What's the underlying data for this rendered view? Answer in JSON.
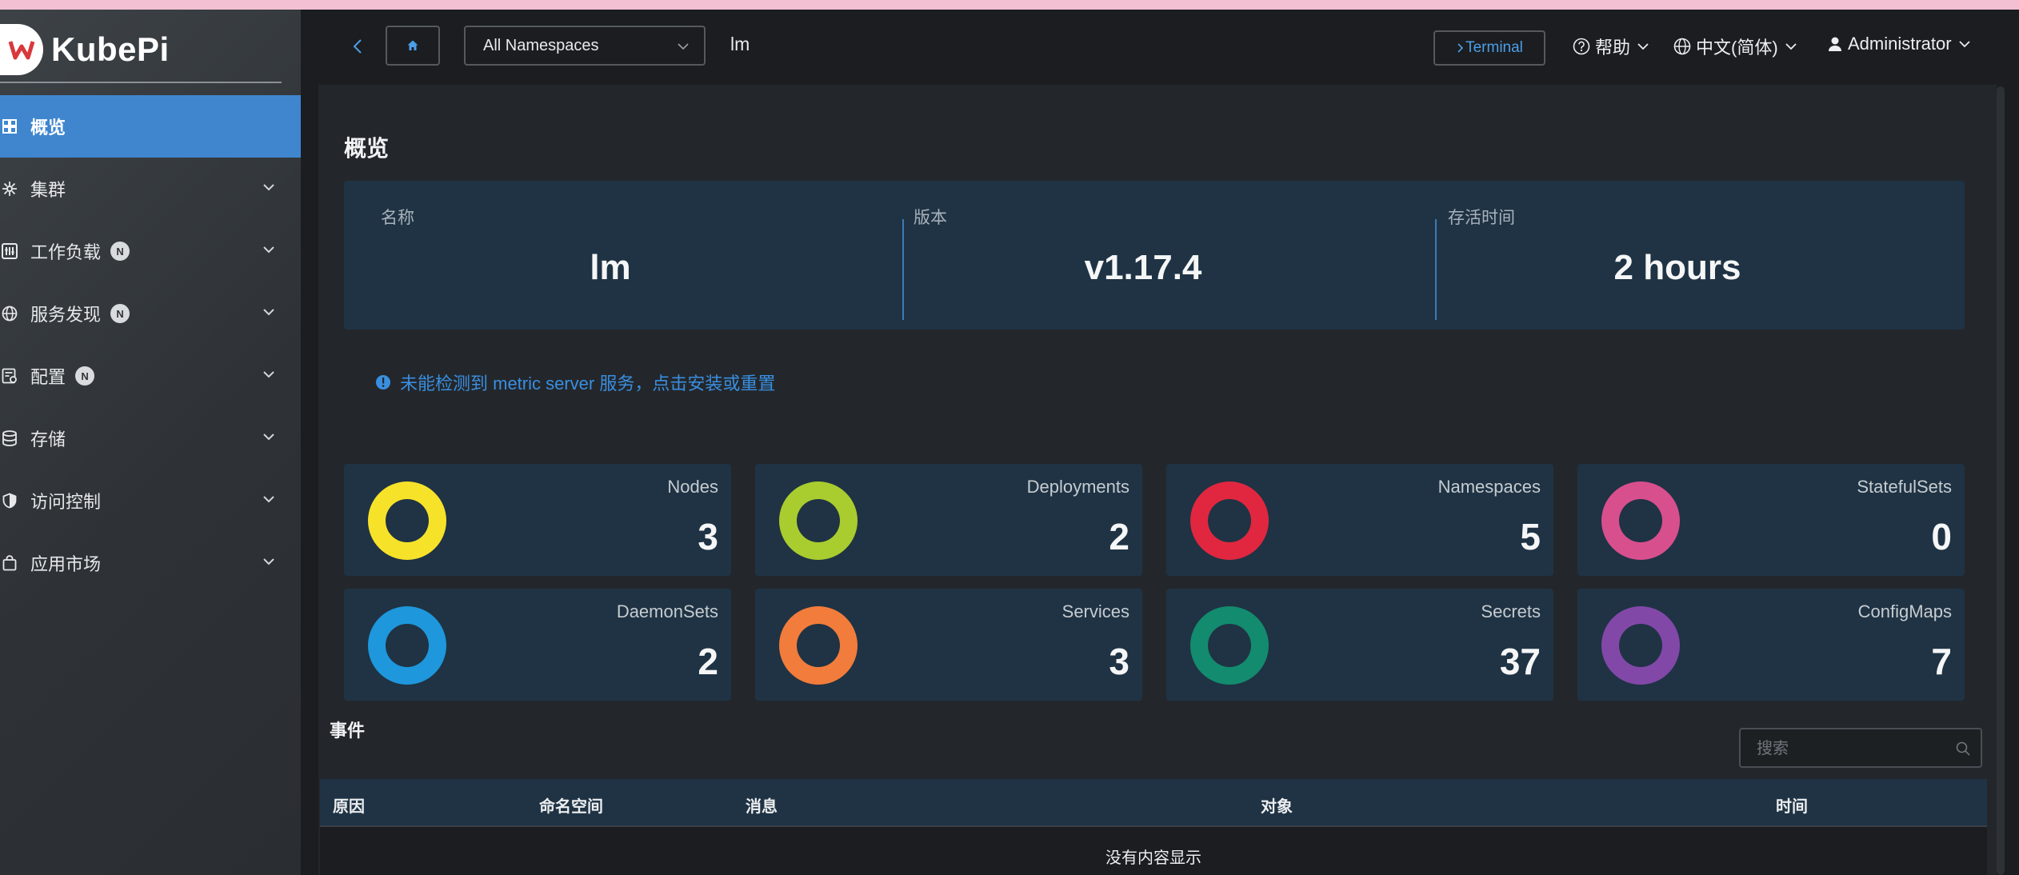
{
  "brand": {
    "name": "KubePi"
  },
  "sidebar": {
    "items": [
      {
        "label": "概览",
        "icon": "dashboard-icon",
        "active": true,
        "badge": "",
        "expandable": false
      },
      {
        "label": "集群",
        "icon": "cluster-icon",
        "active": false,
        "badge": "",
        "expandable": true
      },
      {
        "label": "工作负载",
        "icon": "workload-icon",
        "active": false,
        "badge": "N",
        "expandable": true
      },
      {
        "label": "服务发现",
        "icon": "globe-icon",
        "active": false,
        "badge": "N",
        "expandable": true
      },
      {
        "label": "配置",
        "icon": "config-icon",
        "active": false,
        "badge": "N",
        "expandable": true
      },
      {
        "label": "存储",
        "icon": "database-icon",
        "active": false,
        "badge": "",
        "expandable": true
      },
      {
        "label": "访问控制",
        "icon": "shield-icon",
        "active": false,
        "badge": "",
        "expandable": true
      },
      {
        "label": "应用市场",
        "icon": "bag-icon",
        "active": false,
        "badge": "",
        "expandable": true
      }
    ]
  },
  "topbar": {
    "namespace_select": "All Namespaces",
    "cluster": "lm",
    "terminal_label": "Terminal",
    "help_label": "帮助",
    "language_label": "中文(简体)",
    "user_label": "Administrator"
  },
  "overview": {
    "title": "概览",
    "name_label": "名称",
    "name_value": "lm",
    "version_label": "版本",
    "version_value": "v1.17.4",
    "uptime_label": "存活时间",
    "uptime_value": "2 hours"
  },
  "alert": {
    "text": "未能检测到 metric server 服务，点击安装或重置"
  },
  "stats": [
    {
      "name": "Nodes",
      "count": "3",
      "color": "#f7e22a"
    },
    {
      "name": "Deployments",
      "count": "2",
      "color": "#a9cc2f"
    },
    {
      "name": "Namespaces",
      "count": "5",
      "color": "#e0273f"
    },
    {
      "name": "StatefulSets",
      "count": "0",
      "color": "#d84f8e"
    },
    {
      "name": "DaemonSets",
      "count": "2",
      "color": "#1e97dc"
    },
    {
      "name": "Services",
      "count": "3",
      "color": "#f27c3b"
    },
    {
      "name": "Secrets",
      "count": "37",
      "color": "#138b6e"
    },
    {
      "name": "ConfigMaps",
      "count": "7",
      "color": "#8248a8"
    }
  ],
  "events": {
    "title": "事件",
    "search_placeholder": "搜索",
    "columns": [
      "原因",
      "命名空间",
      "消息",
      "对象",
      "时间"
    ],
    "empty_text": "没有内容显示"
  }
}
